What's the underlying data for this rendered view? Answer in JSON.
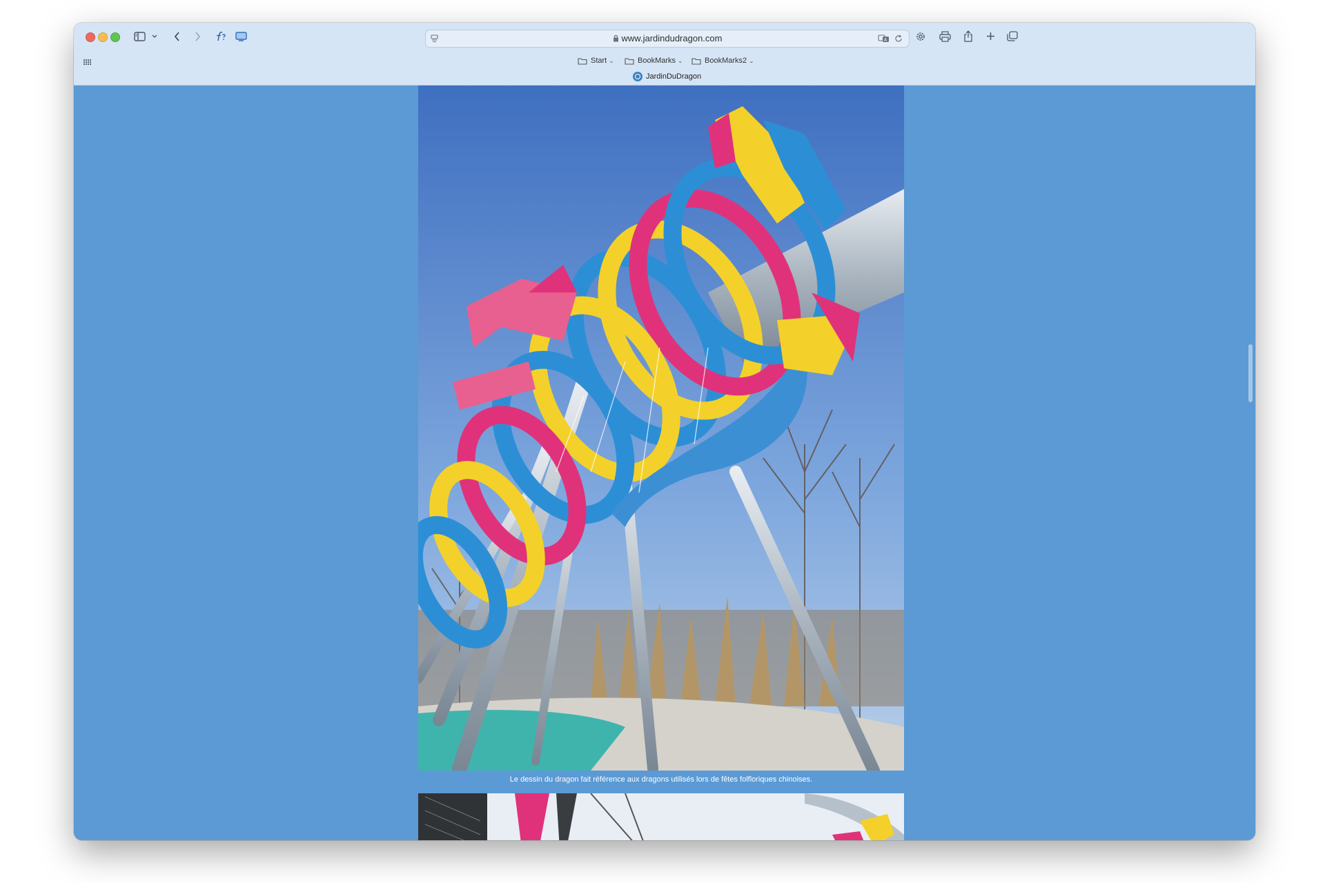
{
  "browser": {
    "url": "www.jardindudragon.com",
    "tab_title": "JardinDuDragon",
    "bookmarks": [
      {
        "label": "Start"
      },
      {
        "label": "BookMarks"
      },
      {
        "label": "BookMarks2"
      }
    ],
    "toolbar_icons": [
      "sidebar-icon",
      "chevron-down-icon",
      "back-icon",
      "forward-icon",
      "formula-icon",
      "screen-icon",
      "reader-icon",
      "lock-icon",
      "translate-icon",
      "reload-icon",
      "gear-icon",
      "print-icon",
      "share-icon",
      "plus-icon",
      "tabs-icon",
      "grid-icon"
    ]
  },
  "page": {
    "background_color": "#5b9ad4",
    "caption": "Le dessin du dragon fait référence aux dragons utilisés lors de fêtes folfloriques chinoises."
  }
}
